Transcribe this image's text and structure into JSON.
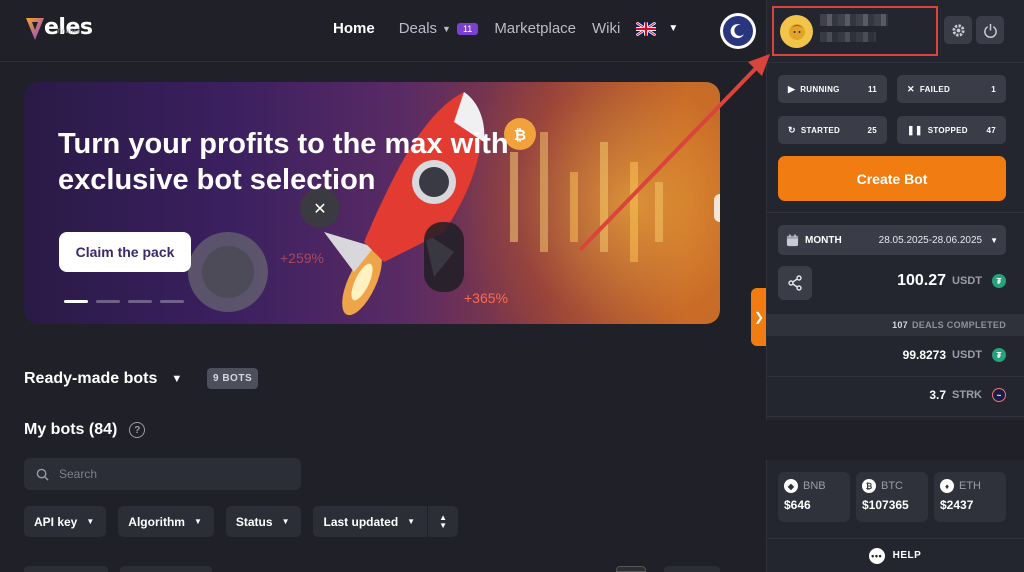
{
  "brand": {
    "name": "eles",
    "sub": "finance"
  },
  "nav": {
    "home": "Home",
    "deals": "Deals",
    "deals_badge": "11",
    "marketplace": "Marketplace",
    "wiki": "Wiki"
  },
  "banner": {
    "title": "Turn your profits to the max with exclusive bot selection",
    "cta": "Claim the pack",
    "pct_a": "+259%",
    "pct_b": "+365%"
  },
  "bots": {
    "ready_made": "Ready-made bots",
    "ready_badge": "9 BOTS",
    "my_bots": "My bots (84)",
    "help": "?",
    "search_placeholder": "Search",
    "filters": [
      "API key",
      "Algorithm",
      "Status",
      "Last updated"
    ]
  },
  "sidebar": {
    "stats": {
      "running": {
        "label": "RUNNING",
        "value": "11"
      },
      "failed": {
        "label": "FAILED",
        "value": "1"
      },
      "started": {
        "label": "STARTED",
        "value": "25"
      },
      "stopped": {
        "label": "STOPPED",
        "value": "47"
      }
    },
    "create_bot": "Create Bot",
    "period": {
      "label": "MONTH",
      "range": "28.05.2025-28.06.2025"
    },
    "total": {
      "value": "100.27",
      "currency": "USDT"
    },
    "deals_completed": {
      "count": "107",
      "label": "DEALS COMPLETED"
    },
    "profits": [
      {
        "value": "99.8273",
        "currency": "USDT"
      },
      {
        "value": "3.7",
        "currency": "STRK"
      }
    ],
    "prices": [
      {
        "symbol": "BNB",
        "price": "$646"
      },
      {
        "symbol": "BTC",
        "price": "$107365"
      },
      {
        "symbol": "ETH",
        "price": "$2437"
      }
    ],
    "help": "HELP"
  },
  "colors": {
    "accent": "#f07c12",
    "highlight_box": "#d9453a",
    "deals_badge": "#7b3fd1",
    "background": "#1f2028",
    "sidebar": "#24262f"
  },
  "icons": {
    "theme": "moon-icon",
    "settings": "gear-icon",
    "logout": "power-icon",
    "share": "share-icon",
    "calendar": "calendar-icon"
  }
}
